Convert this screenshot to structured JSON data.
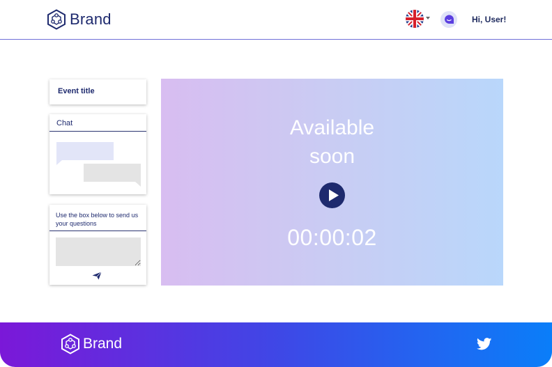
{
  "header": {
    "brand": "Brand",
    "greeting": "Hi, User!",
    "language_icon": "uk-flag-icon",
    "avatar_icon": "avatar-icon"
  },
  "sidebar": {
    "event_title": "Event title",
    "chat_title": "Chat",
    "question_prompt": "Use the box below to send us your questions",
    "send_icon": "send-icon"
  },
  "video": {
    "status": "Available soon",
    "timer": "00:00:02",
    "play_icon": "play-icon"
  },
  "footer": {
    "brand": "Brand",
    "social_icon": "twitter-icon"
  },
  "colors": {
    "brand_navy": "#1e2a6e",
    "video_gradient_start": "#d8bdf1",
    "video_gradient_end": "#b9d7fb",
    "footer_gradient_start": "#7b18d8",
    "footer_gradient_end": "#0a7ef9"
  }
}
